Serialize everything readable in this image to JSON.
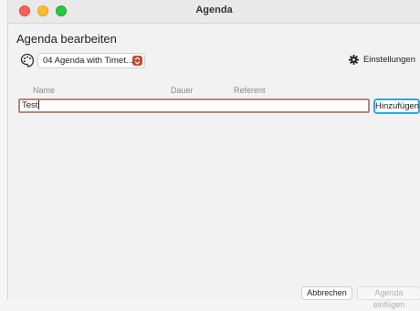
{
  "window": {
    "title": "Agenda"
  },
  "page": {
    "heading": "Agenda bearbeiten"
  },
  "template_select": {
    "value": "04 Agenda with Timet..."
  },
  "settings": {
    "label": "Einstellungen"
  },
  "table": {
    "columns": [
      "Name",
      "Dauer",
      "Referent"
    ]
  },
  "new_item": {
    "value": "Test"
  },
  "buttons": {
    "add_label": "Hinzufügen",
    "cancel_label": "Abbrechen",
    "insert_label": "Agenda einfügen"
  },
  "icons": {
    "palette": "palette-icon",
    "gear": "gear-icon",
    "chevron": "chevron-updown-icon"
  },
  "colors": {
    "accent_focus": "#2ba6e0",
    "input_border": "#b98580",
    "select_chevron": "#c9482c",
    "traffic_red": "#fe5f57",
    "traffic_yellow": "#febc2e",
    "traffic_green": "#28c840"
  }
}
